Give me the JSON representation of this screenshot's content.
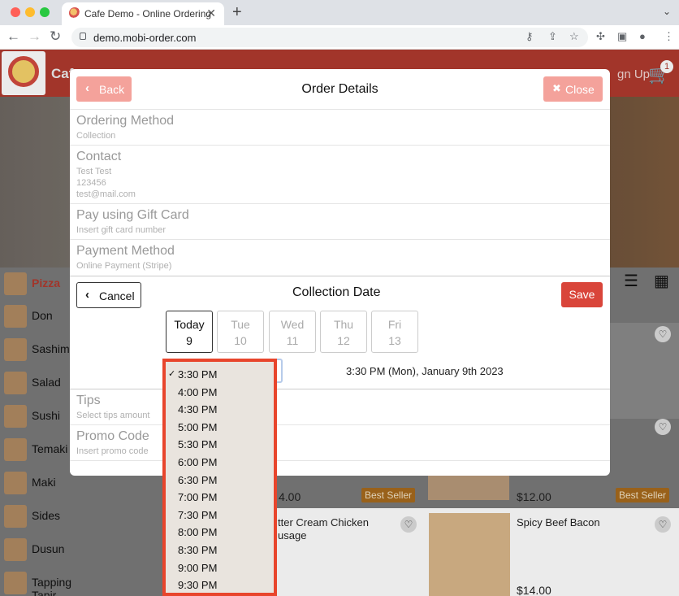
{
  "browser": {
    "tab_title": "Cafe Demo - Online Ordering",
    "url": "demo.mobi-order.com"
  },
  "app": {
    "brand": "Cafe",
    "signup": "gn Up",
    "cart_count": "1"
  },
  "categories": [
    {
      "label": "Pizza",
      "active": true
    },
    {
      "label": "Don"
    },
    {
      "label": "Sashimi"
    },
    {
      "label": "Salad"
    },
    {
      "label": "Sushi"
    },
    {
      "label": "Temaki"
    },
    {
      "label": "Maki"
    },
    {
      "label": "Sides"
    },
    {
      "label": "Dusun"
    },
    {
      "label": "Tapping Tapir"
    }
  ],
  "products": {
    "price_1": "4.00",
    "price_2": "$12.00",
    "price_3": "$14.00",
    "best_seller": "Best Seller",
    "name_1": "tter Cream Chicken",
    "name_1b": "usage",
    "name_2": "Spicy Beef Bacon"
  },
  "modal": {
    "back_label": "Back",
    "title": "Order Details",
    "close_label": "Close",
    "ordering_method": {
      "title": "Ordering Method",
      "value": "Collection"
    },
    "contact": {
      "title": "Contact",
      "name": "Test Test",
      "phone": "123456",
      "email": "test@mail.com"
    },
    "gift_card": {
      "title": "Pay using Gift Card",
      "value": "Insert gift card number"
    },
    "payment": {
      "title": "Payment Method",
      "value": "Online Payment (Stripe)"
    },
    "tips": {
      "title": "Tips",
      "value": "Select tips amount"
    },
    "promo": {
      "title": "Promo Code",
      "value": "Insert promo code"
    }
  },
  "collection": {
    "cancel_label": "Cancel",
    "title": "Collection Date",
    "save_label": "Save",
    "days": [
      {
        "name": "Today",
        "num": "9",
        "selected": true
      },
      {
        "name": "Tue",
        "num": "10"
      },
      {
        "name": "Wed",
        "num": "11"
      },
      {
        "name": "Thu",
        "num": "12"
      },
      {
        "name": "Fri",
        "num": "13"
      }
    ],
    "selected_text": "3:30 PM (Mon), January 9th 2023"
  },
  "time_options": [
    {
      "label": "3:30 PM",
      "checked": true
    },
    {
      "label": "4:00 PM"
    },
    {
      "label": "4:30 PM"
    },
    {
      "label": "5:00 PM"
    },
    {
      "label": "5:30 PM"
    },
    {
      "label": "6:00 PM"
    },
    {
      "label": "6:30 PM"
    },
    {
      "label": "7:00 PM"
    },
    {
      "label": "7:30 PM"
    },
    {
      "label": "8:00 PM"
    },
    {
      "label": "8:30 PM"
    },
    {
      "label": "9:00 PM"
    },
    {
      "label": "9:30 PM"
    }
  ],
  "colors": {
    "header_red": "#b03a2e",
    "button_salmon": "#f4a29b",
    "save_red": "#d9453a",
    "dropdown_highlight": "#e8452c"
  }
}
